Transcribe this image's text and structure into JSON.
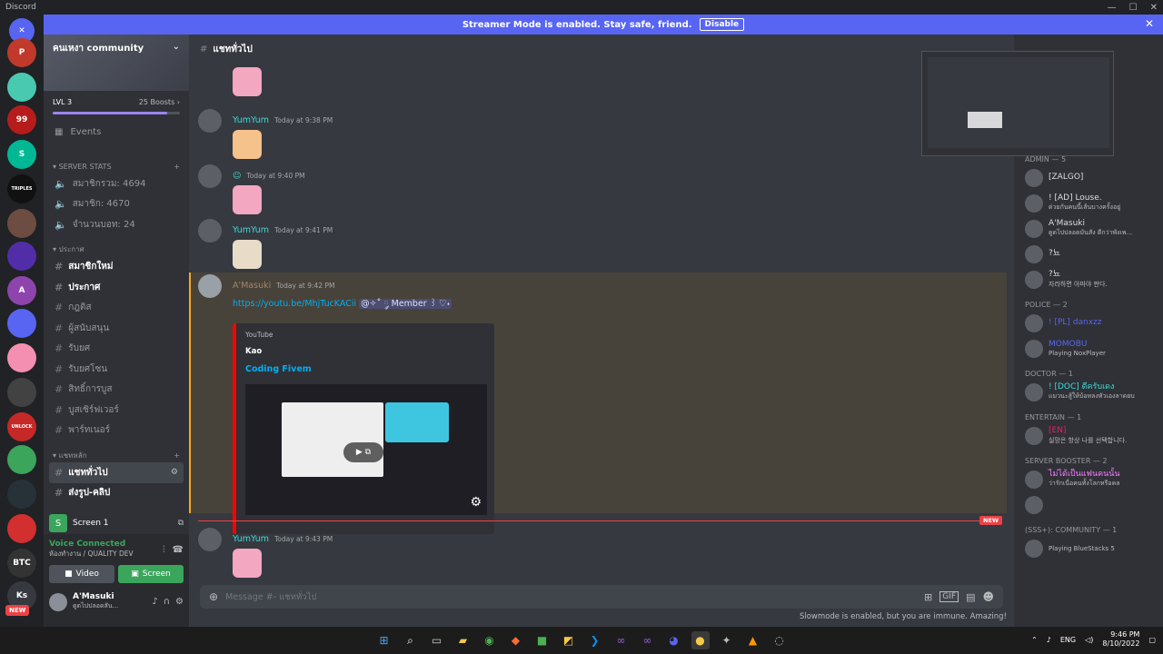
{
  "app": {
    "title": "Discord"
  },
  "banner": {
    "text": "Streamer Mode is enabled. Stay safe, friend.",
    "button": "Disable"
  },
  "guilds": [
    {
      "label": "P",
      "color": "#c0392b"
    },
    {
      "label": "",
      "color": "#49c9b0"
    },
    {
      "label": "99",
      "color": "#b71c1c"
    },
    {
      "label": "S",
      "color": "#00b894"
    },
    {
      "label": "TRIPLES",
      "color": "#111111"
    },
    {
      "label": "",
      "color": "#6d4c41"
    },
    {
      "label": "",
      "color": "#512da8"
    },
    {
      "label": "A",
      "color": "#8e44ad"
    },
    {
      "label": "",
      "color": "#5865f2"
    },
    {
      "label": "",
      "color": "#f48fb1"
    },
    {
      "label": "",
      "color": "#424242"
    },
    {
      "label": "UNLOCK",
      "color": "#c62828"
    },
    {
      "label": "",
      "color": "#3ba55c"
    },
    {
      "label": "",
      "color": "#263238"
    },
    {
      "label": "",
      "color": "#d32f2f"
    },
    {
      "label": "BTC",
      "color": "#333333"
    },
    {
      "label": "Ks",
      "color": "#36393f"
    }
  ],
  "new_badge": "NEW",
  "server": {
    "name": "คนเหงา community",
    "level": "LVL 3",
    "boosts": "25 Boosts",
    "events": "Events"
  },
  "categories": {
    "stats": "SERVER STATS",
    "announce": "ประกาศ",
    "general": "แชทหลัก"
  },
  "channels": [
    {
      "name": "สมาชิกรวม: 4694",
      "bold": false
    },
    {
      "name": "สมาชิก: 4670",
      "bold": false
    },
    {
      "name": "จำนวนบอท: 24",
      "bold": false
    },
    {
      "name": "สมาชิกใหม่",
      "bold": true
    },
    {
      "name": "ประกาศ",
      "bold": true
    },
    {
      "name": "กฎติส",
      "bold": false
    },
    {
      "name": "ผู้สนับสนุน",
      "bold": false
    },
    {
      "name": "รับยศ",
      "bold": false
    },
    {
      "name": "รับยศโซน",
      "bold": false
    },
    {
      "name": "สิทธิ์การบูส",
      "bold": false
    },
    {
      "name": "บูสเซิร์ฟเวอร์",
      "bold": false
    },
    {
      "name": "พาร์ทเนอร์",
      "bold": false
    },
    {
      "name": "แชททั่วไป",
      "bold": true,
      "selected": true
    },
    {
      "name": "ส่งรูป-คลิป",
      "bold": true
    }
  ],
  "screen_share": {
    "label": "Screen 1"
  },
  "voice": {
    "status": "Voice Connected",
    "channel": "ห้องทำงาน / QUALITY DEV",
    "video": "Video",
    "screen": "Screen"
  },
  "user": {
    "name": "A'Masuki",
    "status": "ดูดไปปลอดสัน..."
  },
  "channel_header": {
    "name": "แชททั่วไป"
  },
  "messages": [
    {
      "author": "YumYum",
      "time": "Today at 9:38 PM"
    },
    {
      "author": "",
      "time": "Today at 9:40 PM"
    },
    {
      "author": "YumYum",
      "time": "Today at 9:41 PM"
    },
    {
      "author": "A'Masuki",
      "time": "Today at 9:42 PM",
      "link": "https://youtu.be/MhjTucKACii",
      "mention": "@✧˚ ༘ Member ꒱ ♡˖"
    },
    {
      "author": "YumYum",
      "time": "Today at 9:43 PM"
    }
  ],
  "embed": {
    "provider": "YouTube",
    "author": "Kao",
    "title": "Coding Fivem"
  },
  "new_marker": "NEW",
  "composer": {
    "placeholder": "Message #- ",
    "channel": "แชททั่วไป"
  },
  "slowmode": "Slowmode is enabled, but you are immune. Amazing!",
  "members": {
    "groups": [
      {
        "title": "ADMIN — 5",
        "items": [
          {
            "name": "[ZALGO]",
            "sub": "",
            "color": "#dcddde"
          },
          {
            "name": "! [AD] Louse.",
            "sub": "ด่วยกันคนนี้เส้นบางครั้งอยู่",
            "color": "#dcddde"
          },
          {
            "name": "A'Masuki",
            "sub": "ดูดไปปลอดมันสัง ดีกว่าพังเพ...",
            "color": "#dcddde"
          },
          {
            "name": "?뇨",
            "sub": "",
            "color": "#dcddde"
          },
          {
            "name": "?뇨",
            "sub": "자라하면 아파야 판다.",
            "color": "#dcddde"
          }
        ]
      },
      {
        "title": "POLICE — 2",
        "items": [
          {
            "name": "! [PL] danxzz",
            "sub": "",
            "color": "#5865f2"
          },
          {
            "name": "MOMOBU",
            "sub": "Playing NoxPlayer",
            "color": "#5865f2"
          }
        ]
      },
      {
        "title": "DOCTOR — 1",
        "items": [
          {
            "name": "! [DOC] ดีครับเดง",
            "sub": "แมวนะสู้ให้บ้อหลงหัวเองลาดยบ",
            "color": "#3ddbd9"
          }
        ]
      },
      {
        "title": "ENTERTAIN — 1",
        "items": [
          {
            "name": "[EN]",
            "sub": "실망은 항상 나를 선택합니다.",
            "color": "#e91e63"
          }
        ]
      },
      {
        "title": "Server Booster — 2",
        "items": [
          {
            "name": "ไม่ได้เป็นแฟนคนนั้น",
            "sub": "ว่ารักเนื่อคนทั้งโลกหรือคล",
            "color": "#f47fff"
          },
          {
            "name": "",
            "sub": "",
            "color": "#dcddde"
          }
        ]
      },
      {
        "title": "(SSS+): Community — 1",
        "items": [
          {
            "name": "",
            "sub": "Playing BlueStacks 5",
            "color": "#ed4245"
          }
        ]
      }
    ]
  },
  "tray": {
    "lang": "ENG",
    "time": "9:46 PM",
    "date": "8/10/2022"
  }
}
